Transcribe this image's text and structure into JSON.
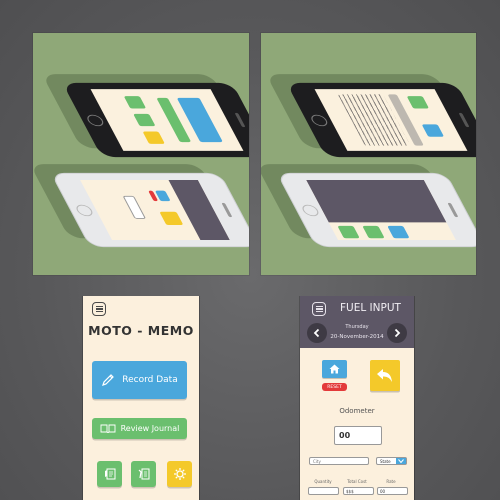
{
  "colors": {
    "background": "#58585a",
    "panel_green": "#8fa878",
    "screen_cream": "#fcf0dd",
    "blue": "#4aa7dc",
    "green": "#6bbf6e",
    "yellow": "#f4c92a",
    "red": "#e33a3a",
    "header_purple": "#5d5766"
  },
  "mockups": {
    "left_panel": {
      "phones": [
        "black-iphone-moto-memo-home",
        "white-iphone-fuel-input"
      ]
    },
    "right_panel": {
      "phones": [
        "black-iphone-fuel-log",
        "white-iphone-side-menu"
      ]
    }
  },
  "home_screen": {
    "menu_icon": "hamburger-menu-icon",
    "title": "MOTO - MEMO",
    "record_button": {
      "label": "Record Data",
      "icon": "pencil-icon"
    },
    "review_button": {
      "label": "Review Journal",
      "icon": "open-book-icon"
    },
    "tiles": [
      {
        "name": "fuel-log",
        "icon": "notepad-fuel-icon",
        "color": "green"
      },
      {
        "name": "maintenance-log",
        "icon": "notepad-wrench-icon",
        "color": "green"
      },
      {
        "name": "settings",
        "icon": "gear-icon",
        "color": "yellow"
      }
    ]
  },
  "fuel_screen": {
    "title": "FUEL INPUT",
    "day": "Thursday",
    "date": "20-November-2014",
    "home_icon": "home-icon",
    "reset_label": "RESET",
    "back_icon": "back-arrow-icon",
    "odometer_label": "Odometer",
    "odometer_value": "00",
    "city_placeholder": "City",
    "state_label": "State",
    "columns": [
      "Quantity",
      "Total Cost",
      "Rate"
    ],
    "quantity_value": "",
    "total_cost_value": "$$$",
    "rate_value": "00"
  }
}
